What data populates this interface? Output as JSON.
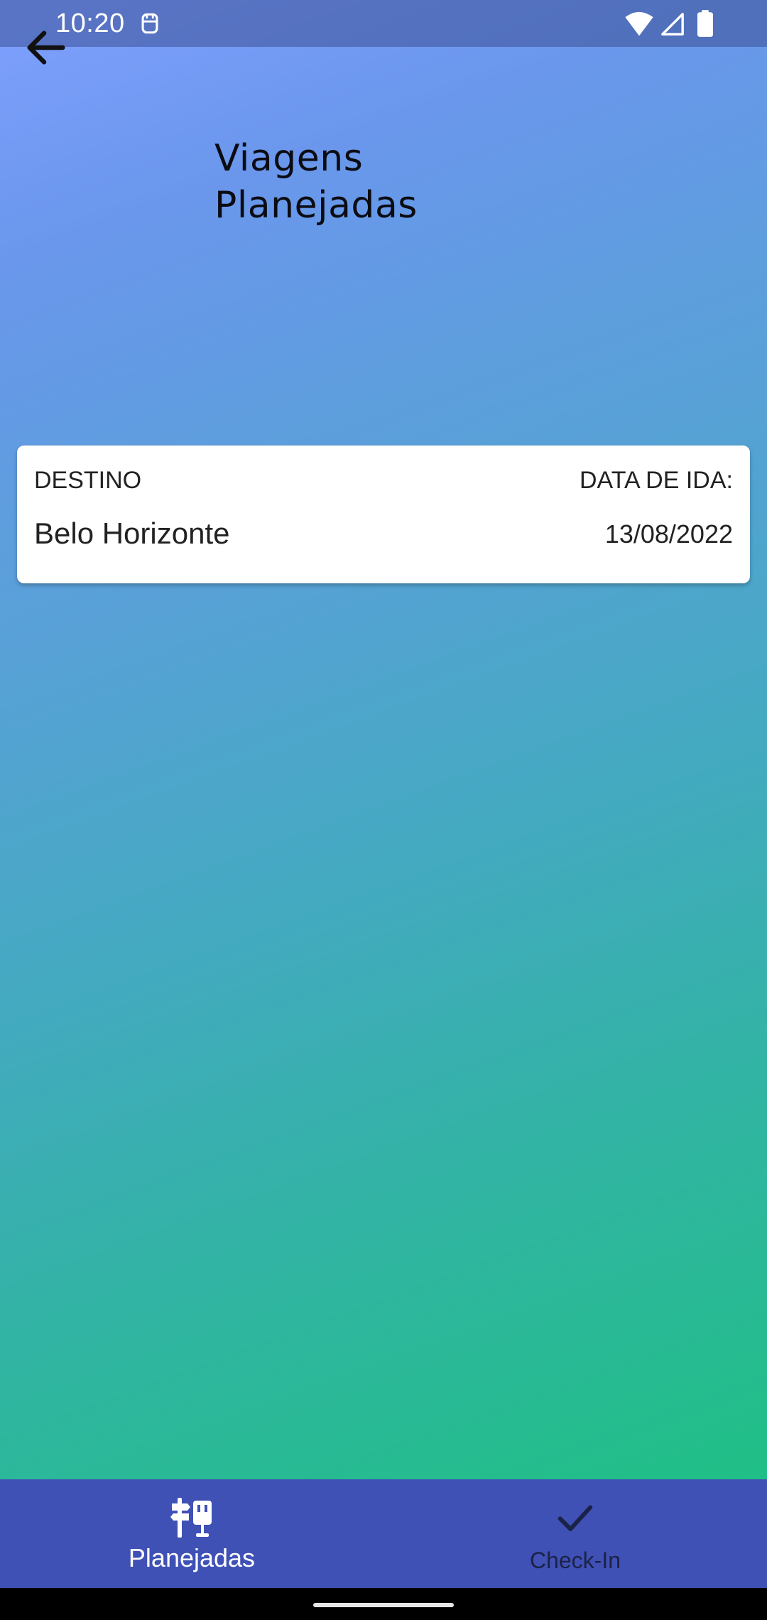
{
  "status_bar": {
    "time": "10:20",
    "icons": [
      "notification-icon",
      "wifi-icon",
      "signal-icon",
      "battery-icon"
    ]
  },
  "header": {
    "back_icon": "arrow-left-icon",
    "title_line1": "Viagens",
    "title_line2": "Planejadas"
  },
  "trip_card": {
    "destination_label": "DESTINO",
    "date_label": "DATA DE IDA:",
    "destination": "Belo Horizonte",
    "date": "13/08/2022"
  },
  "bottom_nav": {
    "items": [
      {
        "label": "Planejadas",
        "icon": "signpost-luggage-icon",
        "active": true
      },
      {
        "label": "Check-In",
        "icon": "checkmark-icon",
        "active": false
      }
    ]
  },
  "colors": {
    "nav_background": "#3f51b5",
    "gradient_top": "#7fa0ff",
    "gradient_bottom": "#20bf86",
    "card_background": "#ffffff"
  }
}
